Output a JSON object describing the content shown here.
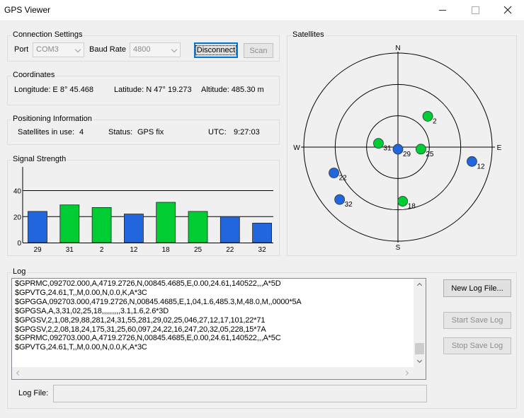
{
  "window": {
    "title": "GPS Viewer"
  },
  "connection": {
    "group_label": "Connection Settings",
    "port_label": "Port",
    "port_value": "COM3",
    "baud_label": "Baud Rate",
    "baud_value": "4800",
    "disconnect_label": "Disconnect",
    "scan_label": "Scan"
  },
  "coordinates": {
    "group_label": "Coordinates",
    "longitude": "Longitude:  E 8° 45.468",
    "latitude": "Latitude:  N 47° 19.273",
    "altitude": "Altitude:  485.30 m"
  },
  "positioning": {
    "group_label": "Positioning Information",
    "satellites_label": "Satellites in use:",
    "satellites_value": "4",
    "status_label": "Status:",
    "status_value": "GPS fix",
    "utc_label": "UTC:",
    "utc_value": "9:27:03"
  },
  "chart_data": {
    "type": "bar",
    "title": "Signal Strength",
    "categories": [
      "29",
      "31",
      "2",
      "12",
      "18",
      "25",
      "22",
      "32"
    ],
    "values": [
      24,
      29,
      27,
      22,
      31,
      24,
      20,
      15
    ],
    "in_use": [
      false,
      true,
      true,
      false,
      true,
      true,
      false,
      false
    ],
    "yticks": [
      "0",
      "20",
      "40"
    ],
    "ylim": [
      0,
      50
    ],
    "reference_lines": [
      20,
      40
    ],
    "colors": {
      "in_use": "#00cc33",
      "not_in_use": "#2266dd"
    }
  },
  "satellites": {
    "group_label": "Satellites",
    "compass": {
      "n": "N",
      "s": "S",
      "e": "E",
      "w": "W"
    },
    "items": [
      {
        "id": "2",
        "azimuth": 44,
        "elevation": 49,
        "in_use": true
      },
      {
        "id": "31",
        "azimuth": 281,
        "elevation": 71,
        "in_use": true
      },
      {
        "id": "29",
        "azimuth": 180,
        "elevation": 88,
        "in_use": false
      },
      {
        "id": "25",
        "azimuth": 95,
        "elevation": 68,
        "in_use": true
      },
      {
        "id": "12",
        "azimuth": 101,
        "elevation": 18,
        "in_use": false
      },
      {
        "id": "22",
        "azimuth": 248,
        "elevation": 24,
        "in_use": false
      },
      {
        "id": "32",
        "azimuth": 228,
        "elevation": 15,
        "in_use": false
      },
      {
        "id": "18",
        "azimuth": 175,
        "elevation": 38,
        "in_use": true
      }
    ]
  },
  "log": {
    "group_label": "Log",
    "lines": [
      "$GPRMC,092702.000,A,4719.2726,N,00845.4685,E,0.00,24.61,140522,,,A*5D",
      "$GPVTG,24.61,T,,M,0.00,N,0.0,K,A*3C",
      "$GPGGA,092703.000,4719.2726,N,00845.4685,E,1,04,1.6,485.3,M,48.0,M,,0000*5A",
      "$GPGSA,A,3,31,02,25,18,,,,,,,,,3.1,1.6,2.6*3D",
      "$GPGSV,2,1,08,29,88,281,24,31,55,281,29,02,25,046,27,12,17,101,22*71",
      "$GPGSV,2,2,08,18,24,175,31,25,60,097,24,22,16,247,20,32,05,228,15*7A",
      "$GPRMC,092703.000,A,4719.2726,N,00845.4685,E,0.00,24.61,140522,,,A*5C",
      "$GPVTG,24.61,T,,M,0.00,N,0.0,K,A*3C"
    ],
    "new_log_label": "New Log File...",
    "start_label": "Start Save Log",
    "stop_label": "Stop Save Log",
    "file_label": "Log File:",
    "file_value": ""
  }
}
